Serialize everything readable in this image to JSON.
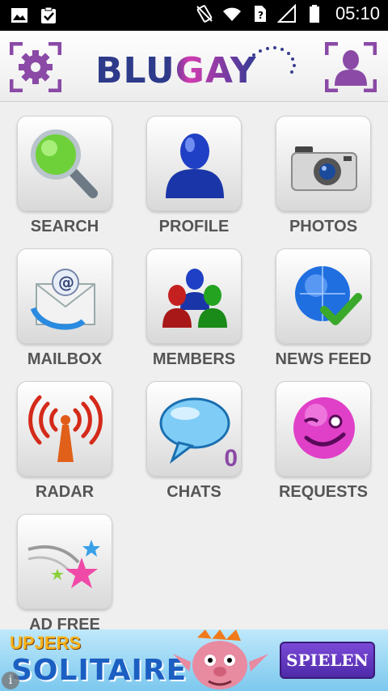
{
  "status_bar": {
    "time": "05:10",
    "icons": [
      "image-icon",
      "clipboard-check-icon",
      "vibrate-icon",
      "wifi-icon",
      "no-sim-icon",
      "signal-icon",
      "battery-icon"
    ]
  },
  "header": {
    "logo_text": "BLUGAY",
    "settings_icon": "gear-icon",
    "profile_icon": "user-icon",
    "accent_color": "#8a4aa6"
  },
  "tiles": [
    {
      "label": "SEARCH",
      "icon": "magnifier-icon"
    },
    {
      "label": "PROFILE",
      "icon": "person-icon"
    },
    {
      "label": "PHOTOS",
      "icon": "camera-icon"
    },
    {
      "label": "MAILBOX",
      "icon": "mail-icon"
    },
    {
      "label": "MEMBERS",
      "icon": "members-icon"
    },
    {
      "label": "NEWS FEED",
      "icon": "globe-check-icon"
    },
    {
      "label": "RADAR",
      "icon": "antenna-icon"
    },
    {
      "label": "CHATS",
      "icon": "speech-bubble-icon",
      "badge": "0"
    },
    {
      "label": "REQUESTS",
      "icon": "smiley-wink-icon"
    },
    {
      "label": "AD FREE",
      "icon": "shooting-stars-icon"
    }
  ],
  "ad": {
    "top_text": "UPJERS",
    "title": "SOLITAIRE",
    "cta": "SPIELEN",
    "info": "i"
  }
}
